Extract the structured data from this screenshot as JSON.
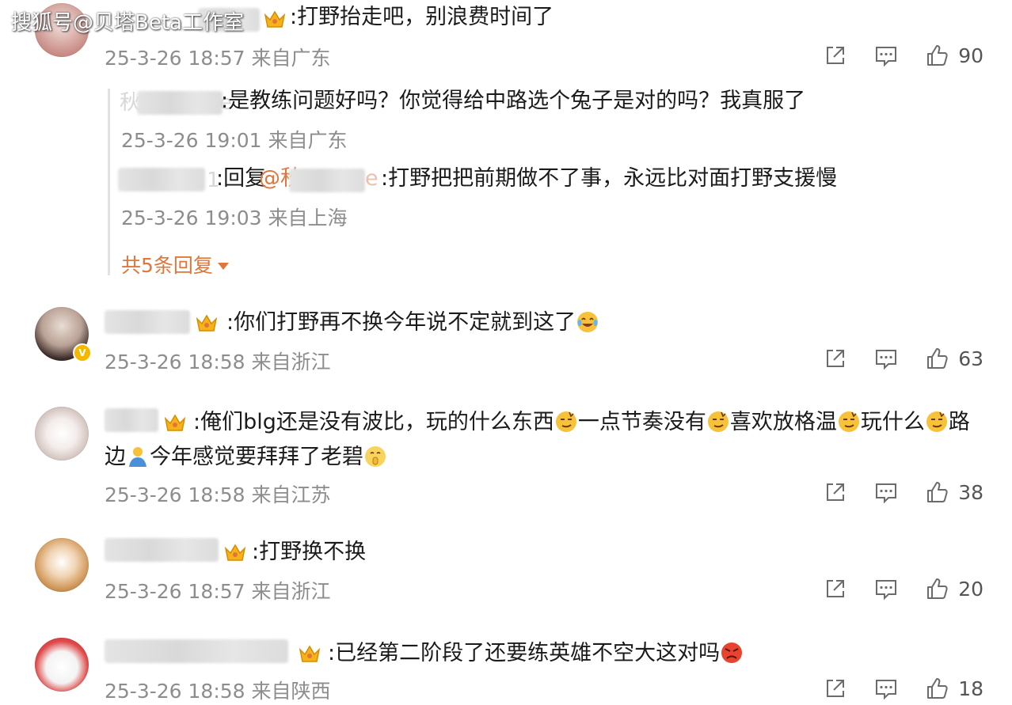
{
  "watermark": "搜狐号@贝塔Beta工作室",
  "comments": [
    {
      "text": ":打野抬走吧，别浪费时间了",
      "meta": "25-3-26 18:57 来自广东",
      "likes": "90"
    },
    {
      "text": ":你们打野再不换今年说不定就到这了",
      "meta": "25-3-26 18:58 来自浙江",
      "likes": "63"
    },
    {
      "text_line1_a": ":俺们blg还是没有波比，玩的什么东西",
      "text_line1_b": "一点节奏没有",
      "text_line1_c": "喜欢放格温",
      "text_line1_d": "玩什么",
      "text_line1_e": "路",
      "text_line2_a": "边",
      "text_line2_b": "今年感觉要拜拜了老碧",
      "meta": "25-3-26 18:58 来自江苏",
      "likes": "38"
    },
    {
      "text": ":打野换不换",
      "meta": "25-3-26 18:57 来自浙江",
      "likes": "20"
    },
    {
      "text": ":已经第二阶段了还要练英雄不空大这对吗",
      "meta": "25-3-26 18:58 来自陕西",
      "likes": "18"
    }
  ],
  "replies": [
    {
      "name_prefix": "秋",
      "name_suffix": "e",
      "text": ":是教练问题好吗？你觉得给中路选个兔子是对的吗？我真服了",
      "meta": "25-3-26 19:01 来自广东"
    },
    {
      "name_suffix": "1",
      "reply_prefix": ":回复",
      "mention": "@秋",
      "mention_suffix": "e",
      "text": ":打野把把前期做不了事，永远比对面打野支援慢",
      "meta": "25-3-26 19:03 来自上海"
    }
  ],
  "more_replies": "共5条回复",
  "icons": {
    "share": "share-icon",
    "reply": "comment-icon",
    "like": "thumbs-up-icon",
    "crown": "crown-badge-icon",
    "verified": "verified-badge-icon"
  },
  "colors": {
    "accent": "#e0763a",
    "meta_text": "#8d8d8d",
    "icon": "#6b6b6b"
  }
}
